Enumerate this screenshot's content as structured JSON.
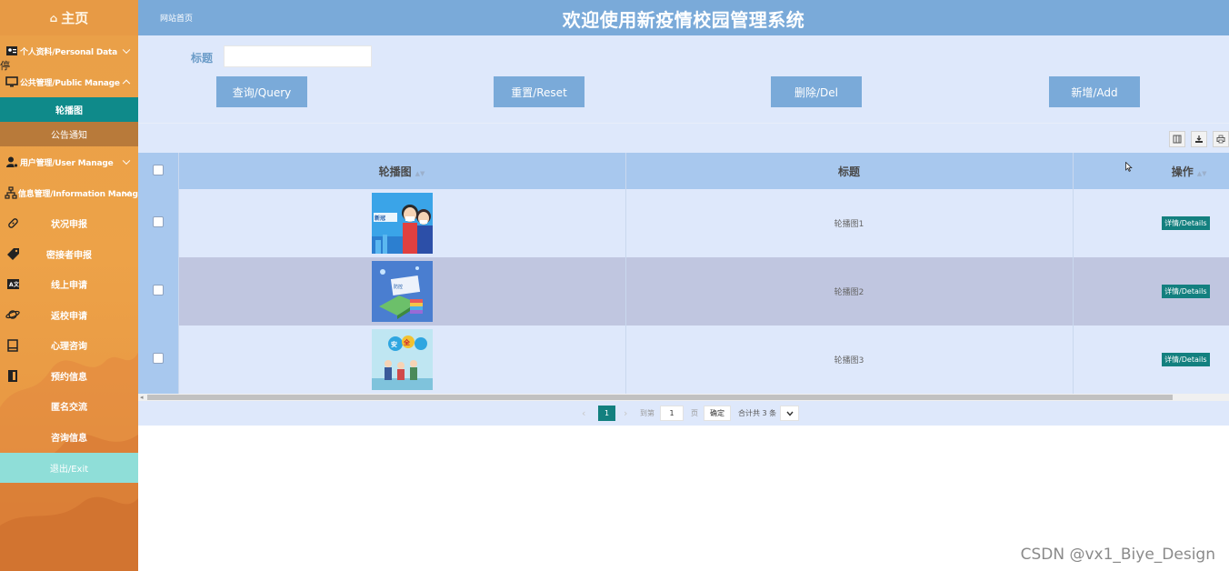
{
  "sidebar": {
    "brand": "主页",
    "stray_text": "停",
    "groups": {
      "personal": "个人资料/Personal Data",
      "public": "公共管理/Public Manage",
      "user": "用户管理/User Manage",
      "info": "信息管理/Information Manage"
    },
    "public_sub": [
      "轮播图",
      "公告通知"
    ],
    "items": [
      "状况申报",
      "密接者申报",
      "线上申请",
      "返校申请",
      "心理咨询",
      "预约信息",
      "匿名交流",
      "咨询信息"
    ],
    "exit": "退出/Exit"
  },
  "header": {
    "home_link": "网站首页",
    "title": "欢迎使用新疫情校园管理系统"
  },
  "search": {
    "label": "标题",
    "value": "",
    "placeholder": "",
    "buttons": {
      "query": "查询/Query",
      "reset": "重置/Reset",
      "delete": "删除/Del",
      "add": "新增/Add"
    }
  },
  "table": {
    "columns": [
      "轮播图",
      "标题",
      "操作"
    ],
    "rows": [
      {
        "title": "轮播图1",
        "action": "详情/Details"
      },
      {
        "title": "轮播图2",
        "action": "详情/Details"
      },
      {
        "title": "轮播图3",
        "action": "详情/Details"
      }
    ]
  },
  "pagination": {
    "current_page": "1",
    "goto_label": "到第",
    "goto_value": "1",
    "page_unit": "页",
    "confirm": "确定",
    "total": "合计共 3 条"
  },
  "watermark": "CSDN @vx1_Biye_Design",
  "colors": {
    "sidebar": "#eda248",
    "header": "#7aaad9",
    "panel": "#dee8fb",
    "table_header": "#a8c8ee",
    "active_teal": "#0f8a8a",
    "exit": "#8fded8"
  }
}
